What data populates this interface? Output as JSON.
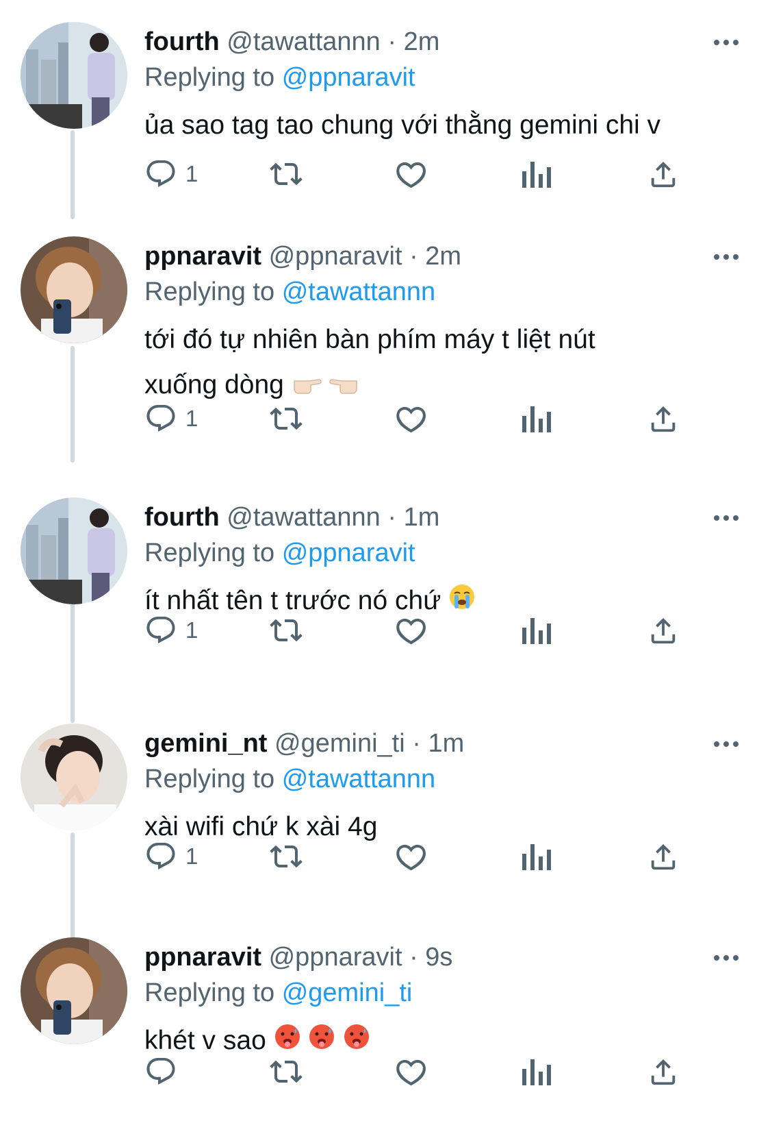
{
  "tweets": [
    {
      "name": "fourth",
      "handle": "@tawattannn",
      "dot": "·",
      "time": "2m",
      "replying_prefix": "Replying to",
      "replying_to": "@ppnaravit",
      "text": "ủa sao tag tao chung với thằng gemini chi v",
      "reply_count": "1"
    },
    {
      "name": "ppnaravit",
      "handle": "@ppnaravit",
      "dot": "·",
      "time": "2m",
      "replying_prefix": "Replying to",
      "replying_to": "@tawattannn",
      "text_line1": "tới đó tự nhiên bàn phím máy t liệt nút",
      "text_line2": "xuống dòng",
      "emojis": [
        "point-right-emoji",
        "point-left-emoji"
      ],
      "reply_count": "1"
    },
    {
      "name": "fourth",
      "handle": "@tawattannn",
      "dot": "·",
      "time": "1m",
      "replying_prefix": "Replying to",
      "replying_to": "@ppnaravit",
      "text": "ít nhất tên t trước nó chứ",
      "emojis": [
        "loudly-crying-face-emoji"
      ],
      "reply_count": "1"
    },
    {
      "name": "gemini_nt",
      "handle": "@gemini_ti",
      "dot": "·",
      "time": "1m",
      "replying_prefix": "Replying to",
      "replying_to": "@tawattannn",
      "text": "xài wifi chứ k xài 4g",
      "reply_count": "1"
    },
    {
      "name": "ppnaravit",
      "handle": "@ppnaravit",
      "dot": "·",
      "time": "9s",
      "replying_prefix": "Replying to",
      "replying_to": "@gemini_ti",
      "text": "khét v sao",
      "emojis": [
        "hot-face-emoji",
        "hot-face-emoji",
        "hot-face-emoji"
      ],
      "reply_count": ""
    }
  ],
  "icons": {
    "reply": "reply-icon",
    "retweet": "retweet-icon",
    "like": "heart-icon",
    "views": "views-icon",
    "share": "share-icon",
    "more": "more-icon"
  },
  "colors": {
    "text": "#0f1419",
    "secondary": "#536471",
    "mention": "#1d9bf0",
    "thread_line": "#cfd9de"
  }
}
